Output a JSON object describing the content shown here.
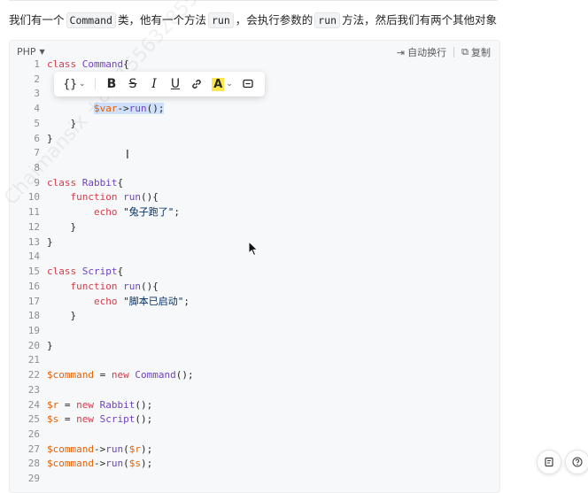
{
  "intro": {
    "t1": "我们有一个",
    "c1": "Command",
    "t2": "类，他有一个方法",
    "c2": "run",
    "t3": "，会执行参数的",
    "c3": "run",
    "t4": "方法，然后我们有两个其他对象"
  },
  "code_block": {
    "language": "PHP",
    "wrap_label": "自动换行",
    "copy_label": "复制",
    "lines": [
      {
        "n": "1",
        "tokens": [
          {
            "t": "class ",
            "k": "kw"
          },
          {
            "t": "Command",
            "k": "cls"
          },
          {
            "t": "{",
            "k": ""
          }
        ]
      },
      {
        "n": "2",
        "tokens": []
      },
      {
        "n": "3",
        "tokens": []
      },
      {
        "n": "4",
        "tokens": [
          {
            "t": "        ",
            "k": ""
          },
          {
            "t": "$var",
            "k": "var sel"
          },
          {
            "t": "->",
            "k": "sel"
          },
          {
            "t": "run",
            "k": "fn sel"
          },
          {
            "t": "();",
            "k": "sel"
          }
        ]
      },
      {
        "n": "5",
        "tokens": [
          {
            "t": "    }",
            "k": ""
          }
        ]
      },
      {
        "n": "6",
        "tokens": [
          {
            "t": "}",
            "k": ""
          }
        ]
      },
      {
        "n": "7",
        "tokens": []
      },
      {
        "n": "8",
        "tokens": []
      },
      {
        "n": "9",
        "tokens": [
          {
            "t": "class ",
            "k": "kw"
          },
          {
            "t": "Rabbit",
            "k": "cls"
          },
          {
            "t": "{",
            "k": ""
          }
        ]
      },
      {
        "n": "10",
        "tokens": [
          {
            "t": "    ",
            "k": ""
          },
          {
            "t": "function ",
            "k": "kw"
          },
          {
            "t": "run",
            "k": "fn"
          },
          {
            "t": "(){",
            "k": ""
          }
        ]
      },
      {
        "n": "11",
        "tokens": [
          {
            "t": "        ",
            "k": ""
          },
          {
            "t": "echo ",
            "k": "kw"
          },
          {
            "t": "\"兔子跑了\"",
            "k": "str"
          },
          {
            "t": ";",
            "k": ""
          }
        ]
      },
      {
        "n": "12",
        "tokens": [
          {
            "t": "    }",
            "k": ""
          }
        ]
      },
      {
        "n": "13",
        "tokens": [
          {
            "t": "}",
            "k": ""
          }
        ]
      },
      {
        "n": "14",
        "tokens": []
      },
      {
        "n": "15",
        "tokens": [
          {
            "t": "class ",
            "k": "kw"
          },
          {
            "t": "Script",
            "k": "cls"
          },
          {
            "t": "{",
            "k": ""
          }
        ]
      },
      {
        "n": "16",
        "tokens": [
          {
            "t": "    ",
            "k": ""
          },
          {
            "t": "function ",
            "k": "kw"
          },
          {
            "t": "run",
            "k": "fn"
          },
          {
            "t": "(){",
            "k": ""
          }
        ]
      },
      {
        "n": "17",
        "tokens": [
          {
            "t": "        ",
            "k": ""
          },
          {
            "t": "echo ",
            "k": "kw"
          },
          {
            "t": "\"脚本已启动\"",
            "k": "str"
          },
          {
            "t": ";",
            "k": ""
          }
        ]
      },
      {
        "n": "18",
        "tokens": [
          {
            "t": "    }",
            "k": ""
          }
        ]
      },
      {
        "n": "19",
        "tokens": []
      },
      {
        "n": "20",
        "tokens": [
          {
            "t": "}",
            "k": ""
          }
        ]
      },
      {
        "n": "21",
        "tokens": []
      },
      {
        "n": "22",
        "tokens": [
          {
            "t": "$command",
            "k": "var"
          },
          {
            "t": " = ",
            "k": ""
          },
          {
            "t": "new ",
            "k": "kw"
          },
          {
            "t": "Command",
            "k": "cls"
          },
          {
            "t": "();",
            "k": ""
          }
        ]
      },
      {
        "n": "23",
        "tokens": []
      },
      {
        "n": "24",
        "tokens": [
          {
            "t": "$r",
            "k": "var"
          },
          {
            "t": " = ",
            "k": ""
          },
          {
            "t": "new ",
            "k": "kw"
          },
          {
            "t": "Rabbit",
            "k": "cls"
          },
          {
            "t": "();",
            "k": ""
          }
        ]
      },
      {
        "n": "25",
        "tokens": [
          {
            "t": "$s",
            "k": "var"
          },
          {
            "t": " = ",
            "k": ""
          },
          {
            "t": "new ",
            "k": "kw"
          },
          {
            "t": "Script",
            "k": "cls"
          },
          {
            "t": "();",
            "k": ""
          }
        ]
      },
      {
        "n": "26",
        "tokens": []
      },
      {
        "n": "27",
        "tokens": [
          {
            "t": "$command",
            "k": "var"
          },
          {
            "t": "->",
            "k": ""
          },
          {
            "t": "run",
            "k": "fn"
          },
          {
            "t": "(",
            "k": ""
          },
          {
            "t": "$r",
            "k": "var"
          },
          {
            "t": ");",
            "k": ""
          }
        ]
      },
      {
        "n": "28",
        "tokens": [
          {
            "t": "$command",
            "k": "var"
          },
          {
            "t": "->",
            "k": ""
          },
          {
            "t": "run",
            "k": "fn"
          },
          {
            "t": "(",
            "k": ""
          },
          {
            "t": "$s",
            "k": "var"
          },
          {
            "t": ");",
            "k": ""
          }
        ]
      },
      {
        "n": "29",
        "tokens": []
      }
    ]
  },
  "floating_toolbar": {
    "code_label": "{}",
    "bold": "B",
    "strike": "S",
    "italic": "I",
    "underline": "U",
    "highlight": "A"
  },
  "watermark": "Chaimansix +86 15563285517",
  "colors": {
    "keyword": "#d73a49",
    "class_name": "#6f42c1",
    "string": "#032f62",
    "variable": "#e36209",
    "selection": "#cfe0fb",
    "highlight_yellow": "#fbe64c"
  }
}
